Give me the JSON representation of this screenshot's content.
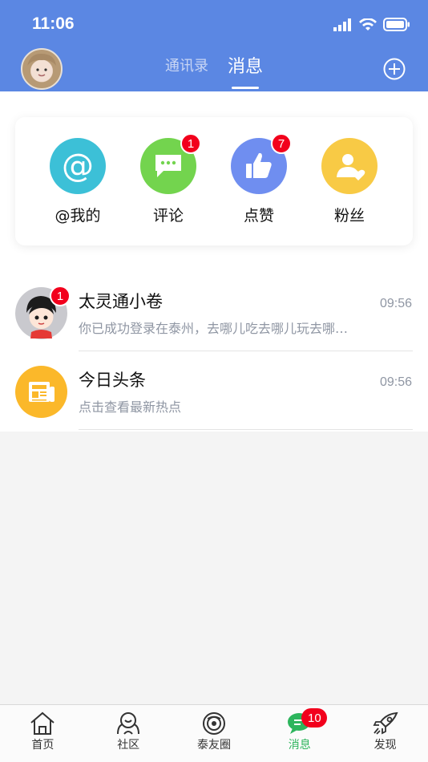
{
  "status_bar": {
    "time": "11:06"
  },
  "header": {
    "tabs": [
      {
        "label": "通讯录",
        "active": false
      },
      {
        "label": "消息",
        "active": true
      }
    ]
  },
  "shortcuts": [
    {
      "label": "@我的",
      "icon": "at-icon",
      "color": "#3cc0d7",
      "badge": ""
    },
    {
      "label": "评论",
      "icon": "comment-icon",
      "color": "#73d44e",
      "badge": "1"
    },
    {
      "label": "点赞",
      "icon": "thumbs-up-icon",
      "color": "#6f8ef0",
      "badge": "7"
    },
    {
      "label": "粉丝",
      "icon": "fans-icon",
      "color": "#f8ca45",
      "badge": ""
    }
  ],
  "messages": [
    {
      "title": "太灵通小卷",
      "subtitle": "你已成功登录在泰州，去哪儿吃去哪儿玩去哪…",
      "time": "09:56",
      "badge": "1"
    },
    {
      "title": "今日头条",
      "subtitle": "点击查看最新热点",
      "time": "09:56",
      "badge": ""
    }
  ],
  "bottom_nav": [
    {
      "label": "首页",
      "icon": "home-icon",
      "active": false
    },
    {
      "label": "社区",
      "icon": "community-icon",
      "active": false
    },
    {
      "label": "泰友圈",
      "icon": "circle-icon",
      "active": false
    },
    {
      "label": "消息",
      "icon": "message-icon",
      "active": true,
      "badge": "10"
    },
    {
      "label": "发现",
      "icon": "rocket-icon",
      "active": false
    }
  ],
  "colors": {
    "header": "#5b87e3",
    "badge": "#f2001c",
    "active_nav": "#2db55d"
  }
}
